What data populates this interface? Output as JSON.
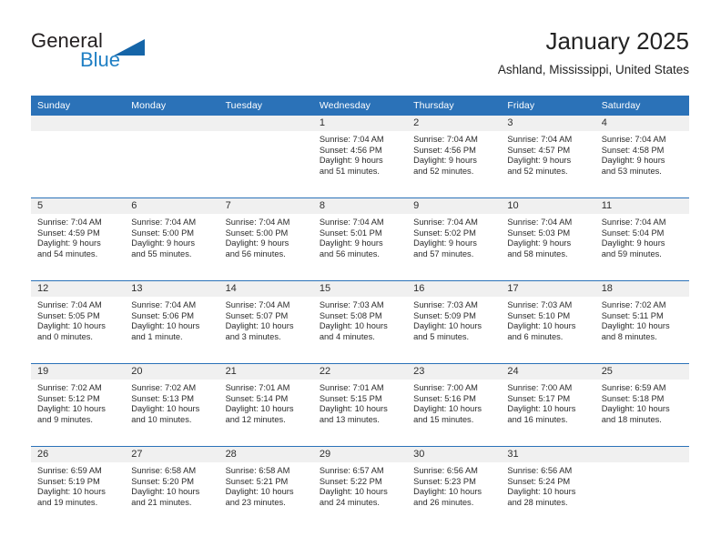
{
  "brand": {
    "name_part1": "General",
    "name_part2": "Blue",
    "flag_icon": "blue-triangle-flag-icon"
  },
  "header": {
    "title": "January 2025",
    "location": "Ashland, Mississippi, United States"
  },
  "colors": {
    "header_blue": "#2b72b8",
    "row_divider_blue": "#2b72b8",
    "daynum_band": "#f0f0f0",
    "brand_blue": "#1f7fc4",
    "text": "#2b2b2b"
  },
  "weekdays": [
    "Sunday",
    "Monday",
    "Tuesday",
    "Wednesday",
    "Thursday",
    "Friday",
    "Saturday"
  ],
  "weeks": [
    [
      {
        "day": "",
        "blank": true,
        "sunrise": "",
        "sunset": "",
        "daylight_line1": "",
        "daylight_line2": ""
      },
      {
        "day": "",
        "blank": true,
        "sunrise": "",
        "sunset": "",
        "daylight_line1": "",
        "daylight_line2": ""
      },
      {
        "day": "",
        "blank": true,
        "sunrise": "",
        "sunset": "",
        "daylight_line1": "",
        "daylight_line2": ""
      },
      {
        "day": "1",
        "sunrise": "Sunrise: 7:04 AM",
        "sunset": "Sunset: 4:56 PM",
        "daylight_line1": "Daylight: 9 hours",
        "daylight_line2": "and 51 minutes."
      },
      {
        "day": "2",
        "sunrise": "Sunrise: 7:04 AM",
        "sunset": "Sunset: 4:56 PM",
        "daylight_line1": "Daylight: 9 hours",
        "daylight_line2": "and 52 minutes."
      },
      {
        "day": "3",
        "sunrise": "Sunrise: 7:04 AM",
        "sunset": "Sunset: 4:57 PM",
        "daylight_line1": "Daylight: 9 hours",
        "daylight_line2": "and 52 minutes."
      },
      {
        "day": "4",
        "sunrise": "Sunrise: 7:04 AM",
        "sunset": "Sunset: 4:58 PM",
        "daylight_line1": "Daylight: 9 hours",
        "daylight_line2": "and 53 minutes."
      }
    ],
    [
      {
        "day": "5",
        "sunrise": "Sunrise: 7:04 AM",
        "sunset": "Sunset: 4:59 PM",
        "daylight_line1": "Daylight: 9 hours",
        "daylight_line2": "and 54 minutes."
      },
      {
        "day": "6",
        "sunrise": "Sunrise: 7:04 AM",
        "sunset": "Sunset: 5:00 PM",
        "daylight_line1": "Daylight: 9 hours",
        "daylight_line2": "and 55 minutes."
      },
      {
        "day": "7",
        "sunrise": "Sunrise: 7:04 AM",
        "sunset": "Sunset: 5:00 PM",
        "daylight_line1": "Daylight: 9 hours",
        "daylight_line2": "and 56 minutes."
      },
      {
        "day": "8",
        "sunrise": "Sunrise: 7:04 AM",
        "sunset": "Sunset: 5:01 PM",
        "daylight_line1": "Daylight: 9 hours",
        "daylight_line2": "and 56 minutes."
      },
      {
        "day": "9",
        "sunrise": "Sunrise: 7:04 AM",
        "sunset": "Sunset: 5:02 PM",
        "daylight_line1": "Daylight: 9 hours",
        "daylight_line2": "and 57 minutes."
      },
      {
        "day": "10",
        "sunrise": "Sunrise: 7:04 AM",
        "sunset": "Sunset: 5:03 PM",
        "daylight_line1": "Daylight: 9 hours",
        "daylight_line2": "and 58 minutes."
      },
      {
        "day": "11",
        "sunrise": "Sunrise: 7:04 AM",
        "sunset": "Sunset: 5:04 PM",
        "daylight_line1": "Daylight: 9 hours",
        "daylight_line2": "and 59 minutes."
      }
    ],
    [
      {
        "day": "12",
        "sunrise": "Sunrise: 7:04 AM",
        "sunset": "Sunset: 5:05 PM",
        "daylight_line1": "Daylight: 10 hours",
        "daylight_line2": "and 0 minutes."
      },
      {
        "day": "13",
        "sunrise": "Sunrise: 7:04 AM",
        "sunset": "Sunset: 5:06 PM",
        "daylight_line1": "Daylight: 10 hours",
        "daylight_line2": "and 1 minute."
      },
      {
        "day": "14",
        "sunrise": "Sunrise: 7:04 AM",
        "sunset": "Sunset: 5:07 PM",
        "daylight_line1": "Daylight: 10 hours",
        "daylight_line2": "and 3 minutes."
      },
      {
        "day": "15",
        "sunrise": "Sunrise: 7:03 AM",
        "sunset": "Sunset: 5:08 PM",
        "daylight_line1": "Daylight: 10 hours",
        "daylight_line2": "and 4 minutes."
      },
      {
        "day": "16",
        "sunrise": "Sunrise: 7:03 AM",
        "sunset": "Sunset: 5:09 PM",
        "daylight_line1": "Daylight: 10 hours",
        "daylight_line2": "and 5 minutes."
      },
      {
        "day": "17",
        "sunrise": "Sunrise: 7:03 AM",
        "sunset": "Sunset: 5:10 PM",
        "daylight_line1": "Daylight: 10 hours",
        "daylight_line2": "and 6 minutes."
      },
      {
        "day": "18",
        "sunrise": "Sunrise: 7:02 AM",
        "sunset": "Sunset: 5:11 PM",
        "daylight_line1": "Daylight: 10 hours",
        "daylight_line2": "and 8 minutes."
      }
    ],
    [
      {
        "day": "19",
        "sunrise": "Sunrise: 7:02 AM",
        "sunset": "Sunset: 5:12 PM",
        "daylight_line1": "Daylight: 10 hours",
        "daylight_line2": "and 9 minutes."
      },
      {
        "day": "20",
        "sunrise": "Sunrise: 7:02 AM",
        "sunset": "Sunset: 5:13 PM",
        "daylight_line1": "Daylight: 10 hours",
        "daylight_line2": "and 10 minutes."
      },
      {
        "day": "21",
        "sunrise": "Sunrise: 7:01 AM",
        "sunset": "Sunset: 5:14 PM",
        "daylight_line1": "Daylight: 10 hours",
        "daylight_line2": "and 12 minutes."
      },
      {
        "day": "22",
        "sunrise": "Sunrise: 7:01 AM",
        "sunset": "Sunset: 5:15 PM",
        "daylight_line1": "Daylight: 10 hours",
        "daylight_line2": "and 13 minutes."
      },
      {
        "day": "23",
        "sunrise": "Sunrise: 7:00 AM",
        "sunset": "Sunset: 5:16 PM",
        "daylight_line1": "Daylight: 10 hours",
        "daylight_line2": "and 15 minutes."
      },
      {
        "day": "24",
        "sunrise": "Sunrise: 7:00 AM",
        "sunset": "Sunset: 5:17 PM",
        "daylight_line1": "Daylight: 10 hours",
        "daylight_line2": "and 16 minutes."
      },
      {
        "day": "25",
        "sunrise": "Sunrise: 6:59 AM",
        "sunset": "Sunset: 5:18 PM",
        "daylight_line1": "Daylight: 10 hours",
        "daylight_line2": "and 18 minutes."
      }
    ],
    [
      {
        "day": "26",
        "sunrise": "Sunrise: 6:59 AM",
        "sunset": "Sunset: 5:19 PM",
        "daylight_line1": "Daylight: 10 hours",
        "daylight_line2": "and 19 minutes."
      },
      {
        "day": "27",
        "sunrise": "Sunrise: 6:58 AM",
        "sunset": "Sunset: 5:20 PM",
        "daylight_line1": "Daylight: 10 hours",
        "daylight_line2": "and 21 minutes."
      },
      {
        "day": "28",
        "sunrise": "Sunrise: 6:58 AM",
        "sunset": "Sunset: 5:21 PM",
        "daylight_line1": "Daylight: 10 hours",
        "daylight_line2": "and 23 minutes."
      },
      {
        "day": "29",
        "sunrise": "Sunrise: 6:57 AM",
        "sunset": "Sunset: 5:22 PM",
        "daylight_line1": "Daylight: 10 hours",
        "daylight_line2": "and 24 minutes."
      },
      {
        "day": "30",
        "sunrise": "Sunrise: 6:56 AM",
        "sunset": "Sunset: 5:23 PM",
        "daylight_line1": "Daylight: 10 hours",
        "daylight_line2": "and 26 minutes."
      },
      {
        "day": "31",
        "sunrise": "Sunrise: 6:56 AM",
        "sunset": "Sunset: 5:24 PM",
        "daylight_line1": "Daylight: 10 hours",
        "daylight_line2": "and 28 minutes."
      },
      {
        "day": "",
        "blank": true,
        "sunrise": "",
        "sunset": "",
        "daylight_line1": "",
        "daylight_line2": ""
      }
    ]
  ]
}
